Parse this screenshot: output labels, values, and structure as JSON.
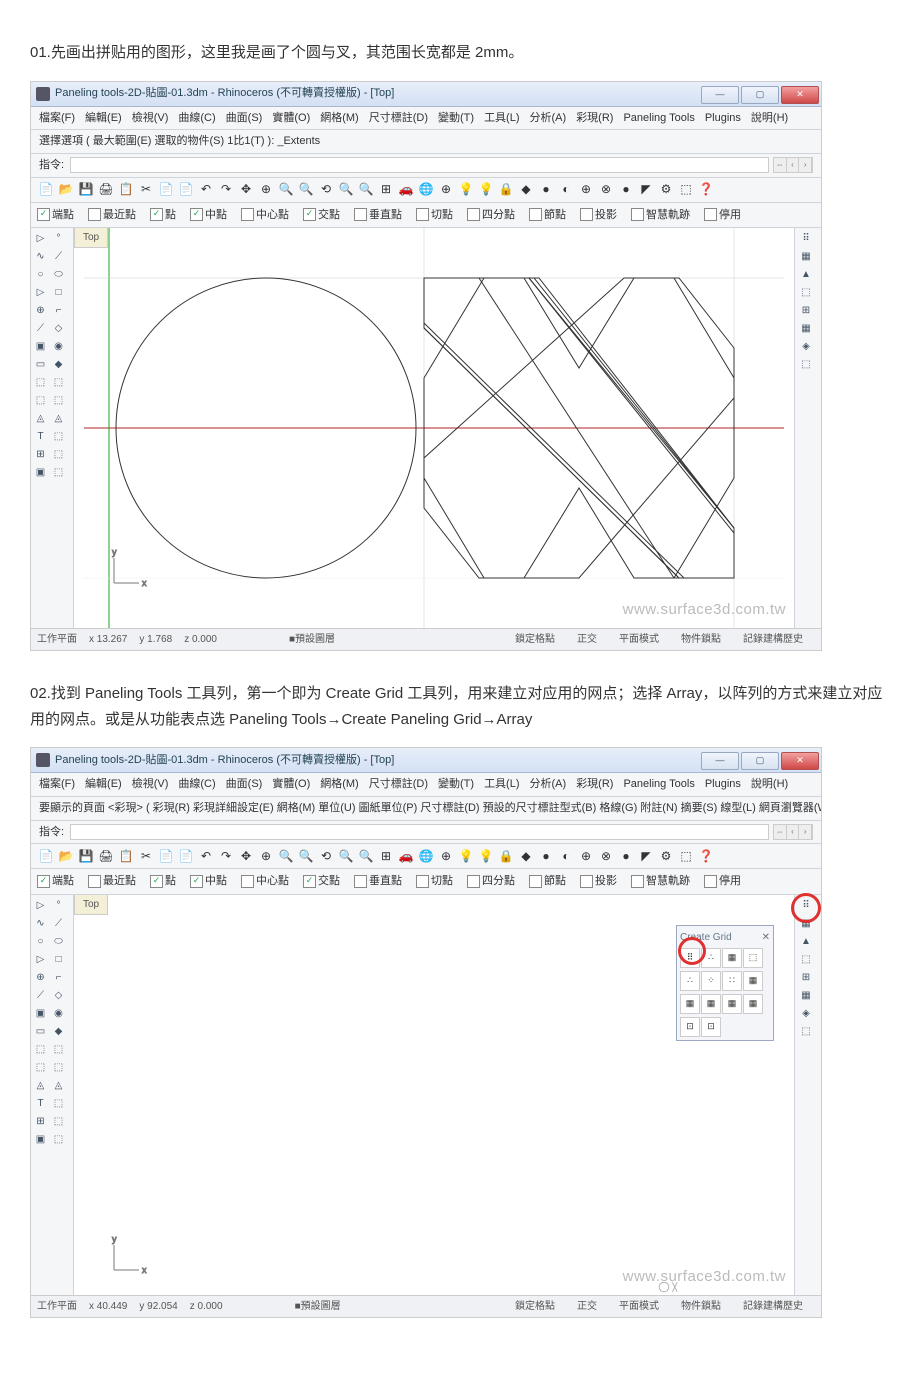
{
  "step1_text": "01.先画出拼贴用的图形，这里我是画了个圆与叉，其范围长宽都是 2mm。",
  "step2_text": "02.找到 Paneling Tools 工具列，第一个即为 Create Grid 工具列，用来建立对应用的网点；选择 Array，以阵列的方式来建立对应用的网点。或是从功能表点选 Paneling Tools→Create Paneling Grid→Array",
  "app": {
    "title": "Paneling tools-2D-貼圖-01.3dm - Rhinoceros (不可轉賣授權版) - [Top]",
    "menus": [
      "檔案(F)",
      "編輯(E)",
      "檢視(V)",
      "曲線(C)",
      "曲面(S)",
      "實體(O)",
      "網格(M)",
      "尺寸標註(D)",
      "變動(T)",
      "工具(L)",
      "分析(A)",
      "彩現(R)",
      "Paneling Tools",
      "Plugins",
      "說明(H)"
    ],
    "cmd1_line1": "選擇選項 ( 最大範圍(E) 選取的物件(S) 1比1(T) ): _Extents",
    "cmd_label": "指令:",
    "cmd2_line1": "要顯示的頁面 <彩現> ( 彩現(R) 彩現詳細設定(E) 網格(M) 單位(U) 圖紙單位(P) 尺寸標註(D) 預設的尺寸標註型式(B) 格線(G) 附註(N) 摘要(S) 線型(L) 網頁瀏覽器(W",
    "osnaps": [
      {
        "label": "端點",
        "on": true
      },
      {
        "label": "最近點",
        "on": false
      },
      {
        "label": "點",
        "on": true
      },
      {
        "label": "中點",
        "on": true
      },
      {
        "label": "中心點",
        "on": false
      },
      {
        "label": "交點",
        "on": true
      },
      {
        "label": "垂直點",
        "on": false
      },
      {
        "label": "切點",
        "on": false
      },
      {
        "label": "四分點",
        "on": false
      },
      {
        "label": "節點",
        "on": false
      },
      {
        "label": "投影",
        "on": false
      },
      {
        "label": "智慧軌跡",
        "on": false
      },
      {
        "label": "停用",
        "on": false
      }
    ],
    "viewport_tab": "Top",
    "status1": {
      "plane": "工作平面",
      "x": "x 13.267",
      "y": "y 1.768",
      "z": "z 0.000",
      "layer": "■預設圖層",
      "right": [
        "鎖定格點",
        "正交",
        "平面模式",
        "物件鎖點",
        "記錄建構歷史"
      ]
    },
    "status2": {
      "plane": "工作平面",
      "x": "x 40.449",
      "y": "y 92.054",
      "z": "z 0.000",
      "layer": "■預設圖層",
      "right": [
        "鎖定格點",
        "正交",
        "平面模式",
        "物件鎖點",
        "記錄建構歷史"
      ]
    },
    "watermark": "www.surface3d.com.tw",
    "panel_title": "Create Grid",
    "panel_close": "✕"
  }
}
